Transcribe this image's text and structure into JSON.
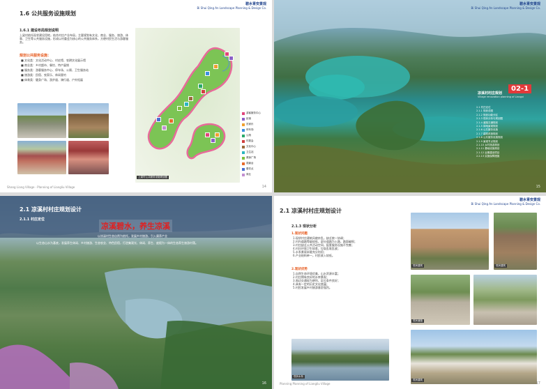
{
  "header": {
    "logo_main": "碧水青安景观",
    "logo_sub": "Bi Shui Qing An Landscape Planning & Design Co."
  },
  "p1": {
    "section": "1.6 公共服务设施规划",
    "subsection": "1.6.1 建设布局规划说明",
    "intro": "上梁村依托现状建设用地，结合村庄产业布局，主要规划有文化、商业、服务、旅游、体育、卫生等公共服务设施，形成以村委会为核心的公共服务体系，方便村民生活与游客服务。",
    "list_title": "规划公共服务设施：",
    "items": [
      "文化类：文化活动中心、村史馆、农耕文化展示馆",
      "商业类：乡村超市、餐饮、特产展销",
      "服务类：游客服务中心、停车场、公厕、卫生服务站",
      "旅游类：民宿、农家乐、休闲垂钓",
      "体育类：健身广场、游步道、骑行道、户外拓展"
    ],
    "map_caption": "上梁村公共服务设施规划图",
    "legend": [
      "游客服务中心",
      "民宿",
      "农家乐",
      "停车场",
      "公厕",
      "村委会",
      "文化中心",
      "卫生站",
      "健身广场",
      "观景台",
      "垂钓点",
      "商业"
    ],
    "legend_colors": [
      "#e0457b",
      "#8b5fc7",
      "#f0a030",
      "#3b8fe0",
      "#29a86a",
      "#d04040",
      "#9a6b3c",
      "#2bb5c0",
      "#7fbf3f",
      "#e86a2a",
      "#4a6fd0",
      "#c28fd0"
    ],
    "footer": "Shang Liang Village · Planning of Liangliu Village",
    "page": "14"
  },
  "p2": {
    "code": "02-1",
    "title": "凉溪村村庄规划",
    "subtitle": "Village renovation planning of Liangxi",
    "toc": [
      "2.1 村庄定位",
      "2.1.1 规划总图",
      "2.1.2 规划功能分区",
      "2.1.3 现状分析与规划图",
      "2.1.4 道路交通规划",
      "2.1.5 绿地景观规划",
      "2.1.6 公共服务设施",
      "2.1.7 建筑改造规划",
      "2.1.8 公共服务设施规划",
      "2.1.9 景观节点规划",
      "2.1.10 乡村旅游规划",
      "2.1.11 基础设施规划",
      "2.1.12 近期建设项目",
      "2.2.13 实施保障措施"
    ],
    "page": "15"
  },
  "p3": {
    "section": "2.1 凉溪村村庄规划设计",
    "subsection": "2.1.1 村庄定位",
    "slogan": "凉溪碧水，养生凉溪",
    "line1": "以凉溪村生态自然为依托，发展乡村旅游，引入康养产业",
    "line2": "以生态山水为基底，发展养生休闲、乡村旅游、生态农业、特色民宿，打造集观光、休闲、养生、度假为一体的生态养生旅游村落。",
    "page": "16"
  },
  "p4": {
    "section": "2.1 凉溪村村庄规划设计",
    "subsection": "2.1.3 现状分析",
    "h1": "1.现状问题",
    "issues": [
      "1.现状村庄建筑风貌杂乱，缺乏统一协调；",
      "2.村内道路等级较低，部分道路为土路，路面破损；",
      "3.村庄缺乏公共活动空间，配套服务设施不完善；",
      "4.村庄环境卫生较差，垃圾乱堆乱放；",
      "5.水系景观未能充分利用；",
      "6.产业结构单一，村民收入较低。"
    ],
    "h2": "2.现状优势",
    "advantages": [
      "1.自然生态环境优美，山水资源丰富；",
      "2.村庄拥有良好的水库景观；",
      "3.周边交通较为便利，区位条件良好；",
      "4.具有一定的历史文化底蕴；",
      "5.村民发展乡村旅游意愿强烈。"
    ],
    "captions": [
      "现状建筑",
      "现状建筑",
      "现状道路",
      "现状道路",
      "现状水系",
      "现状建筑"
    ],
    "footer": "Planning Planning of Liangliu Village",
    "page": "17"
  }
}
